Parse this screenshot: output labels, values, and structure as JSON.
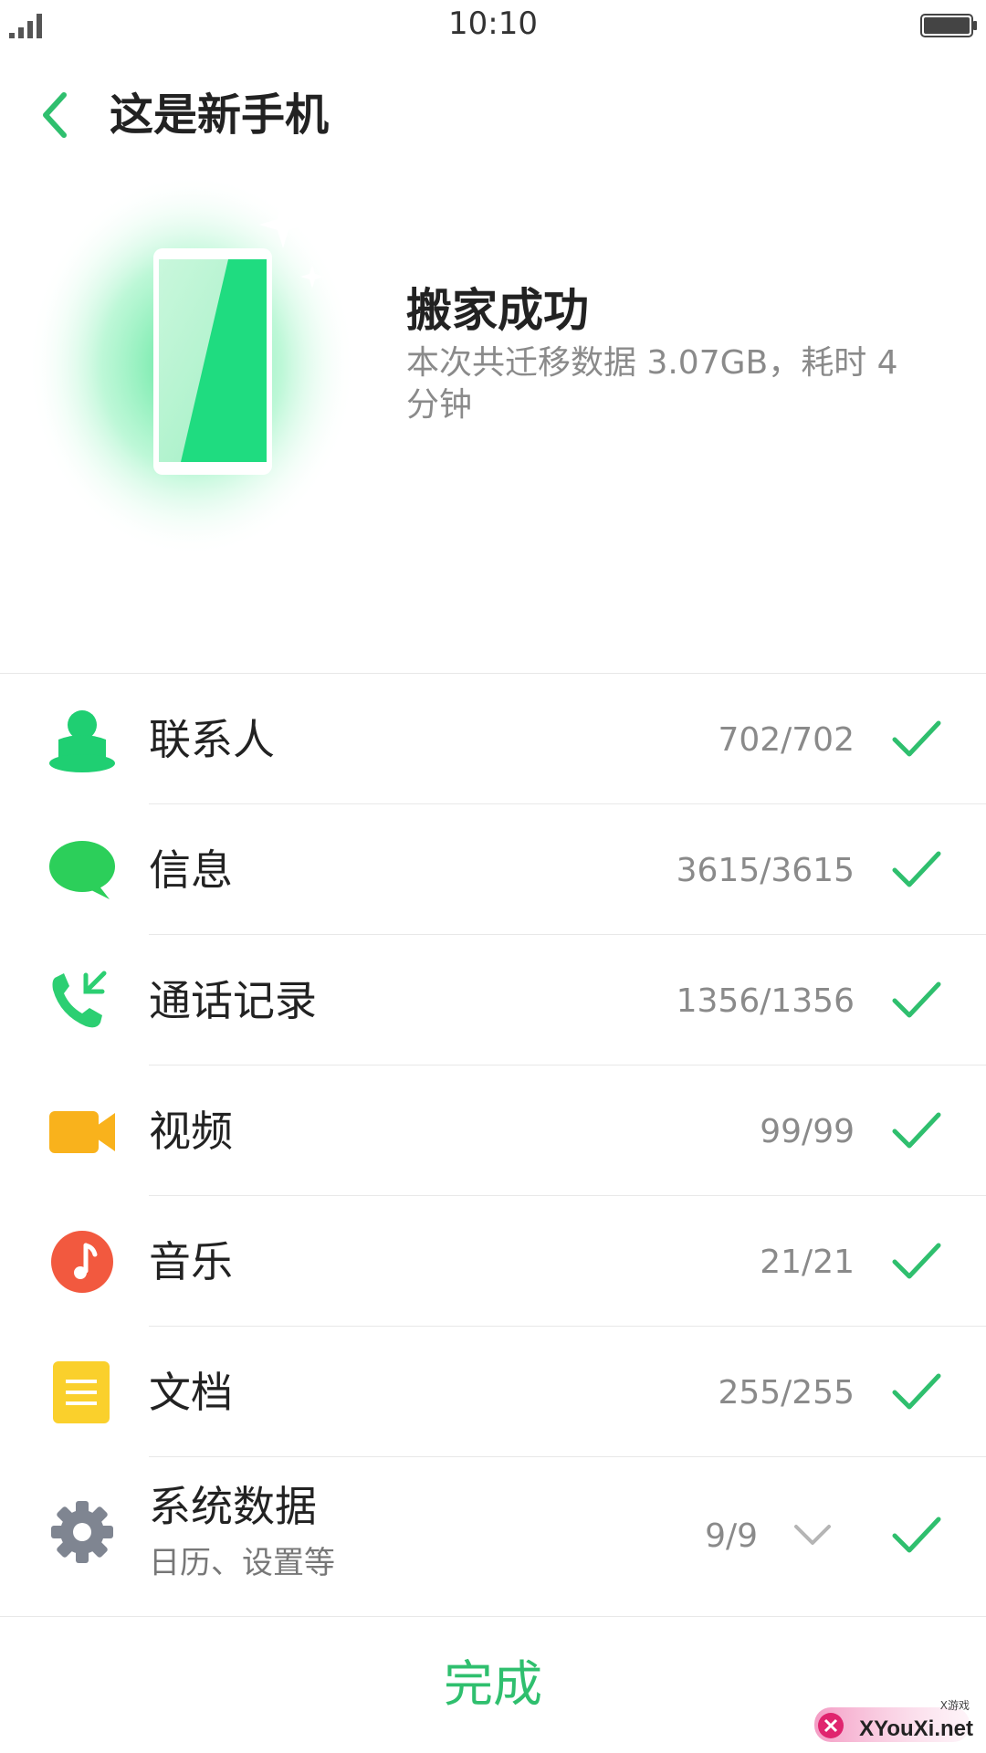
{
  "status_bar": {
    "time": "10:10"
  },
  "header": {
    "title": "这是新手机"
  },
  "hero": {
    "title": "搬家成功",
    "description": "本次共迁移数据 3.07GB，耗时 4 分钟"
  },
  "items": [
    {
      "label": "联系人",
      "count": "702/702",
      "icon": "contact-icon"
    },
    {
      "label": "信息",
      "count": "3615/3615",
      "icon": "message-icon"
    },
    {
      "label": "通话记录",
      "count": "1356/1356",
      "icon": "call-log-icon"
    },
    {
      "label": "视频",
      "count": "99/99",
      "icon": "video-icon"
    },
    {
      "label": "音乐",
      "count": "21/21",
      "icon": "music-icon"
    },
    {
      "label": "文档",
      "count": "255/255",
      "icon": "document-icon"
    },
    {
      "label": "系统数据",
      "sublabel": "日历、设置等",
      "count": "9/9",
      "icon": "gear-icon"
    }
  ],
  "footer": {
    "done_label": "完成"
  },
  "watermark": {
    "text": "XYouXi.net",
    "small": "X游戏"
  },
  "colors": {
    "accent": "#2fbf6e",
    "check": "#2fbf6e"
  }
}
